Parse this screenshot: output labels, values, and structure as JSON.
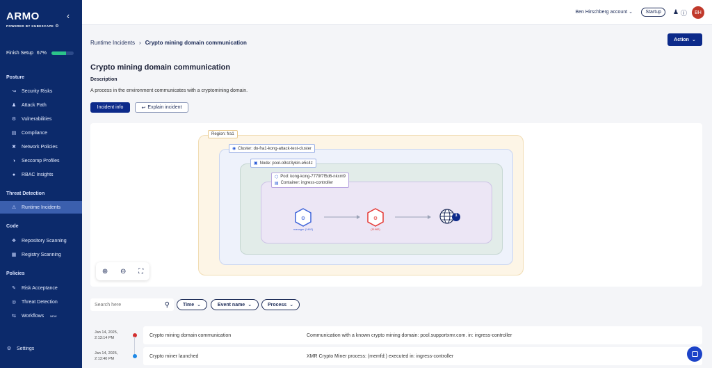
{
  "sidebar": {
    "logo": "ARMO",
    "logo_sub": "POWERED BY KUBESCAPE",
    "finish_label": "Finish Setup",
    "finish_percent": "67%",
    "finish_fraction": 0.67,
    "sections": {
      "posture": "Posture",
      "threat": "Threat Detection",
      "code": "Code",
      "policies": "Policies"
    },
    "items": [
      {
        "label": "Security Risks",
        "icon": "trend-icon"
      },
      {
        "label": "Attack Path",
        "icon": "user-icon"
      },
      {
        "label": "Vulnerabilities",
        "icon": "bug-icon"
      },
      {
        "label": "Compliance",
        "icon": "document-icon"
      },
      {
        "label": "Network Policies",
        "icon": "network-icon"
      },
      {
        "label": "Seccomp Profiles",
        "icon": "shield-icon"
      },
      {
        "label": "RBAC Insights",
        "icon": "person-icon"
      },
      {
        "label": "Runtime Incidents",
        "icon": "warning-icon"
      },
      {
        "label": "Repository Scanning",
        "icon": "repo-icon"
      },
      {
        "label": "Registry Scanning",
        "icon": "registry-icon"
      },
      {
        "label": "Risk Acceptance",
        "icon": "accept-icon"
      },
      {
        "label": "Threat Detection",
        "icon": "target-icon"
      },
      {
        "label": "Workflows",
        "icon": "workflow-icon"
      },
      {
        "label": "Settings",
        "icon": "gear-icon"
      }
    ],
    "workflows_badge": "NEW"
  },
  "topbar": {
    "account": "Ben Hirschberg account",
    "plan": "Startup",
    "avatar": "BH"
  },
  "breadcrumb": {
    "parent": "Runtime Incidents",
    "current": "Crypto mining domain communication"
  },
  "action_label": "Action",
  "page": {
    "title": "Crypto mining domain communication",
    "description_heading": "Description",
    "description": "A process in the environment communicates with a cryptomining domain.",
    "incident_info": "Incident info",
    "explain": "Explain incident"
  },
  "graph": {
    "region": "Region: fra1",
    "cluster": "Cluster: do-fra1-kong-attack-test-cluster",
    "node": "Node: pool-o9oz3ykin-e5c4z",
    "pod": "Pod: kong-kong-7779f7f5d6-nkxm9",
    "container": "Container: ingress-controller",
    "node1_label": "manager (1462)",
    "node2_label": "(11982)",
    "globe_badge": "1",
    "colors": {
      "region": "#fdf3e1",
      "cluster": "#eef2fb",
      "node": "#e2ece9",
      "pod": "#ece6f5"
    }
  },
  "filters": {
    "search_placeholder": "Search here",
    "time": "Time",
    "event_name": "Event name",
    "process": "Process"
  },
  "timeline": [
    {
      "date": "Jan 14, 2025,",
      "time": "2:13:14 PM",
      "name": "Crypto mining domain communication",
      "detail": "Communication with a known crypto mining domain: pool.supportxmr.com. in: ingress-controller",
      "dot": "#d32f2f"
    },
    {
      "date": "Jan 14, 2025,",
      "time": "2:13:40 PM",
      "name": "Crypto miner launched",
      "detail": "XMR Crypto Miner process: (memfd:) executed in: ingress-controller",
      "dot": "#1e88e5"
    }
  ]
}
